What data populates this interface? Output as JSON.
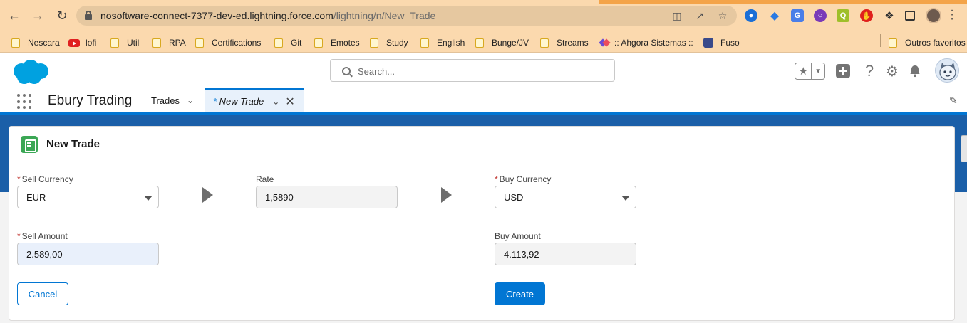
{
  "browser": {
    "url_host": "nosoftware-connect-7377-dev-ed.lightning.force.com",
    "url_path": "/lightning/n/New_Trade",
    "bookmarks": [
      {
        "label": "Nescara",
        "icon": "folder-icon"
      },
      {
        "label": "lofi",
        "icon": "youtube-icon"
      },
      {
        "label": "Util",
        "icon": "folder-icon"
      },
      {
        "label": "RPA",
        "icon": "folder-icon"
      },
      {
        "label": "Certifications",
        "icon": "folder-icon"
      },
      {
        "label": "Git",
        "icon": "folder-icon"
      },
      {
        "label": "Emotes",
        "icon": "folder-icon"
      },
      {
        "label": "Study",
        "icon": "folder-icon"
      },
      {
        "label": "English",
        "icon": "folder-icon"
      },
      {
        "label": "Bunge/JV",
        "icon": "folder-icon"
      },
      {
        "label": "Streams",
        "icon": "folder-icon"
      },
      {
        "label": ":: Ahgora Sistemas ::",
        "icon": "ahgora-icon"
      },
      {
        "label": "Fuso",
        "icon": "fuso-icon"
      }
    ],
    "other_bookmarks": "Outros favoritos"
  },
  "sf_header": {
    "search_placeholder": "Search..."
  },
  "app_nav": {
    "app_name": "Ebury Trading",
    "items": [
      {
        "label": "Trades"
      }
    ],
    "active_tab": {
      "prefix": "* ",
      "label": "New Trade"
    }
  },
  "card": {
    "title": "New Trade",
    "sell_currency": {
      "label": "Sell Currency",
      "value": "EUR",
      "required": true
    },
    "rate": {
      "label": "Rate",
      "value": "1,5890"
    },
    "buy_currency": {
      "label": "Buy Currency",
      "value": "USD",
      "required": true
    },
    "sell_amount": {
      "label": "Sell Amount",
      "value": "2.589,00",
      "required": true
    },
    "buy_amount": {
      "label": "Buy Amount",
      "value": "4.113,92"
    },
    "required_marker": "*",
    "cancel_label": "Cancel",
    "create_label": "Create"
  },
  "colors": {
    "brand": "#0176d3",
    "chrome_bar": "#fbd9ae",
    "required": "#c23934",
    "card_icon": "#3ba755"
  }
}
